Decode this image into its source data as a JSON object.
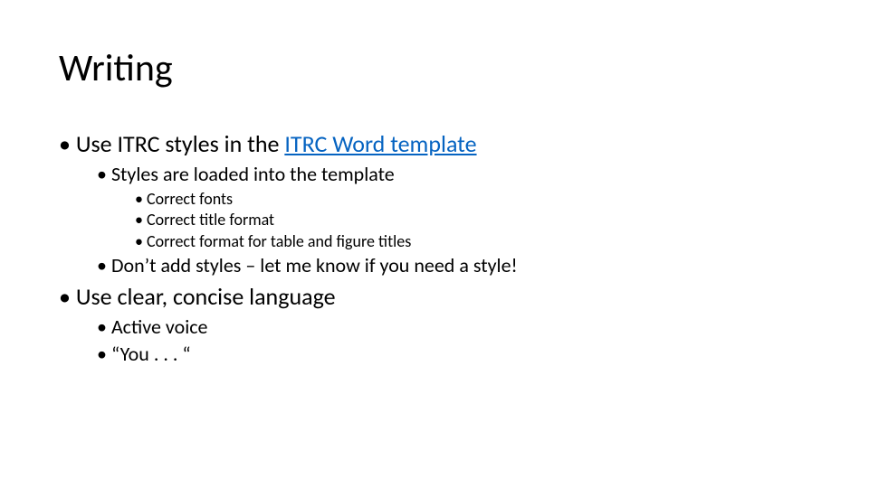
{
  "title": "Writing",
  "l0": {
    "a_pre": "Use ITRC styles in the ",
    "a_link": "ITRC Word template",
    "b": "Use clear, concise language"
  },
  "l1": {
    "a1": "Styles are loaded into the template",
    "a2": "Don’t add styles – let me know if you need a style!",
    "b1": "Active voice",
    "b2": "“You . . . “"
  },
  "l2": {
    "a": "Correct fonts",
    "b": "Correct title format",
    "c": "Correct format for table and figure titles"
  }
}
